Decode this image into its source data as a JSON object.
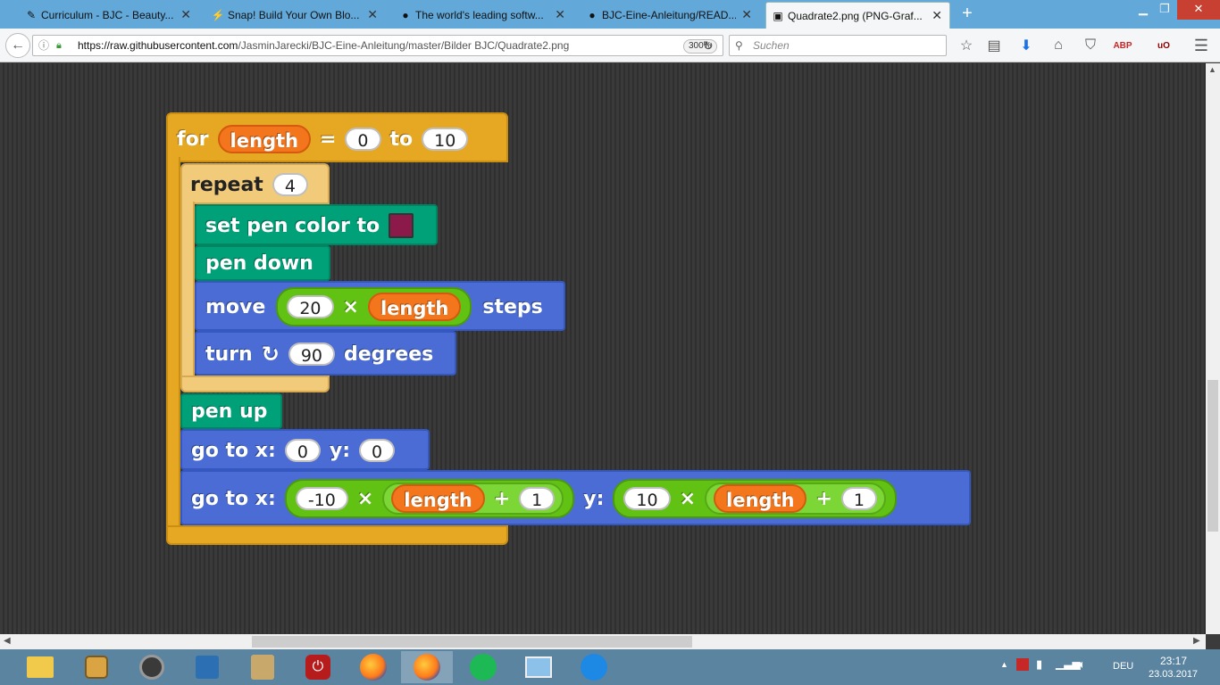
{
  "tabs": [
    {
      "label": "Curriculum - BJC - Beauty...",
      "icon": "puzzle-icon"
    },
    {
      "label": "Snap! Build Your Own Blo...",
      "icon": "snap-icon"
    },
    {
      "label": "The world's leading softw...",
      "icon": "github-icon"
    },
    {
      "label": "BJC-Eine-Anleitung/READ...",
      "icon": "github-icon"
    },
    {
      "label": "Quadrate2.png (PNG-Graf...",
      "icon": "image-icon"
    }
  ],
  "nav": {
    "url_host": "https://raw.githubusercontent.com",
    "url_path": "/JasminJarecki/BJC-Eine-Anleitung/master/Bilder BJC/Quadrate2.png",
    "zoom": "300%",
    "search_placeholder": "Suchen"
  },
  "script": {
    "for_kw": "for",
    "for_var": "length",
    "eq": "=",
    "for_from": "0",
    "to_kw": "to",
    "for_to": "10",
    "repeat_kw": "repeat",
    "repeat_n": "4",
    "setpen": "set pen color to",
    "pen_color": "#8b1a4a",
    "pendown": "pen down",
    "move_kw": "move",
    "move_n": "20",
    "times": "×",
    "move_var": "length",
    "steps": "steps",
    "turn_kw": "turn",
    "turn_n": "90",
    "degrees": "degrees",
    "penup": "pen up",
    "goto1_kw": "go to x:",
    "goto1_x": "0",
    "goto1_y_kw": "y:",
    "goto1_y": "0",
    "goto2_kw": "go to x:",
    "g2_xa": "-10",
    "g2_times1": "×",
    "g2_var1": "length",
    "g2_plus1": "+",
    "g2_one1": "1",
    "g2_y_kw": "y:",
    "g2_ya": "10",
    "g2_times2": "×",
    "g2_var2": "length",
    "g2_plus2": "+",
    "g2_one2": "1"
  },
  "tray": {
    "lang": "DEU",
    "time": "23:17",
    "date": "23.03.2017"
  }
}
